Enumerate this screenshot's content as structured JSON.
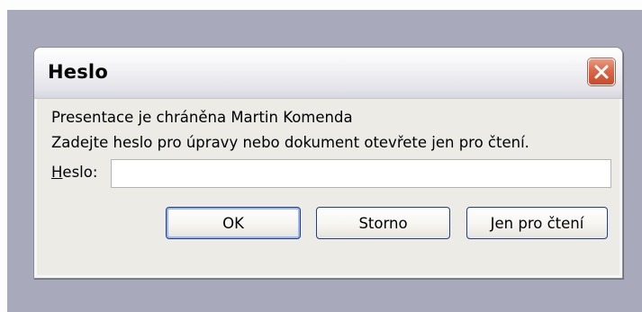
{
  "dialog": {
    "title": "Heslo",
    "message_line1": "Presentace je chráněna Martin Komenda",
    "message_line2": "Zadejte heslo pro úpravy nebo dokument otevřete jen pro čtení.",
    "password_label_accel": "H",
    "password_label_rest": "eslo:",
    "password_value": "",
    "buttons": {
      "ok": "OK",
      "storno": "Storno",
      "readonly_accel": "J",
      "readonly_rest": "en pro čtení"
    }
  },
  "colors": {
    "desktop": "#a8aabc",
    "dialog_body": "#ecebe6",
    "close_button": "#d9684a",
    "button_border": "#1d3f8c"
  },
  "icons": {
    "close": "close-icon"
  }
}
